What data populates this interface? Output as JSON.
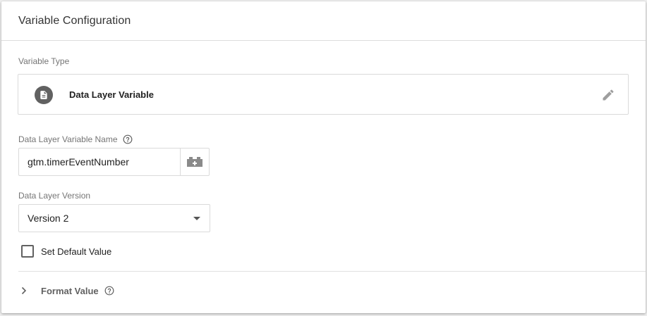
{
  "card": {
    "title": "Variable Configuration"
  },
  "variable_type": {
    "label": "Variable Type",
    "name": "Data Layer Variable",
    "icon": "document-icon"
  },
  "variable_name": {
    "label": "Data Layer Variable Name",
    "value": "gtm.timerEventNumber"
  },
  "data_layer_version": {
    "label": "Data Layer Version",
    "selected": "Version 2"
  },
  "default_value": {
    "label": "Set Default Value",
    "checked": false
  },
  "format_value": {
    "label": "Format Value"
  },
  "colors": {
    "icon_gray": "#616161",
    "border": "#dadada",
    "text": "#212121",
    "muted_label": "#757575"
  }
}
